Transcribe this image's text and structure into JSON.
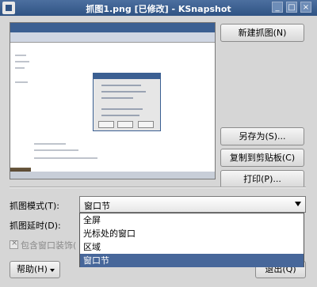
{
  "window": {
    "title": "抓图1.png [已修改] - KSnapshot",
    "icons": [
      "app-icon",
      "minimize-icon",
      "maximize-icon",
      "close-icon"
    ],
    "accent": "#2f5384"
  },
  "buttons": {
    "new_snapshot": "新建抓图(N)",
    "save_as": "另存为(S)...",
    "copy_clipboard": "复制到剪贴板(C)",
    "print": "打印(P)...",
    "help": "帮助(H)",
    "quit": "退出(Q)"
  },
  "capture_mode": {
    "label": "抓图模式(T):",
    "selected": "窗口节",
    "options": [
      "全屏",
      "光标处的窗口",
      "区域",
      "窗口节"
    ]
  },
  "delay": {
    "label": "抓图延时(D):"
  },
  "decorations": {
    "label": "包含窗口装饰("
  }
}
